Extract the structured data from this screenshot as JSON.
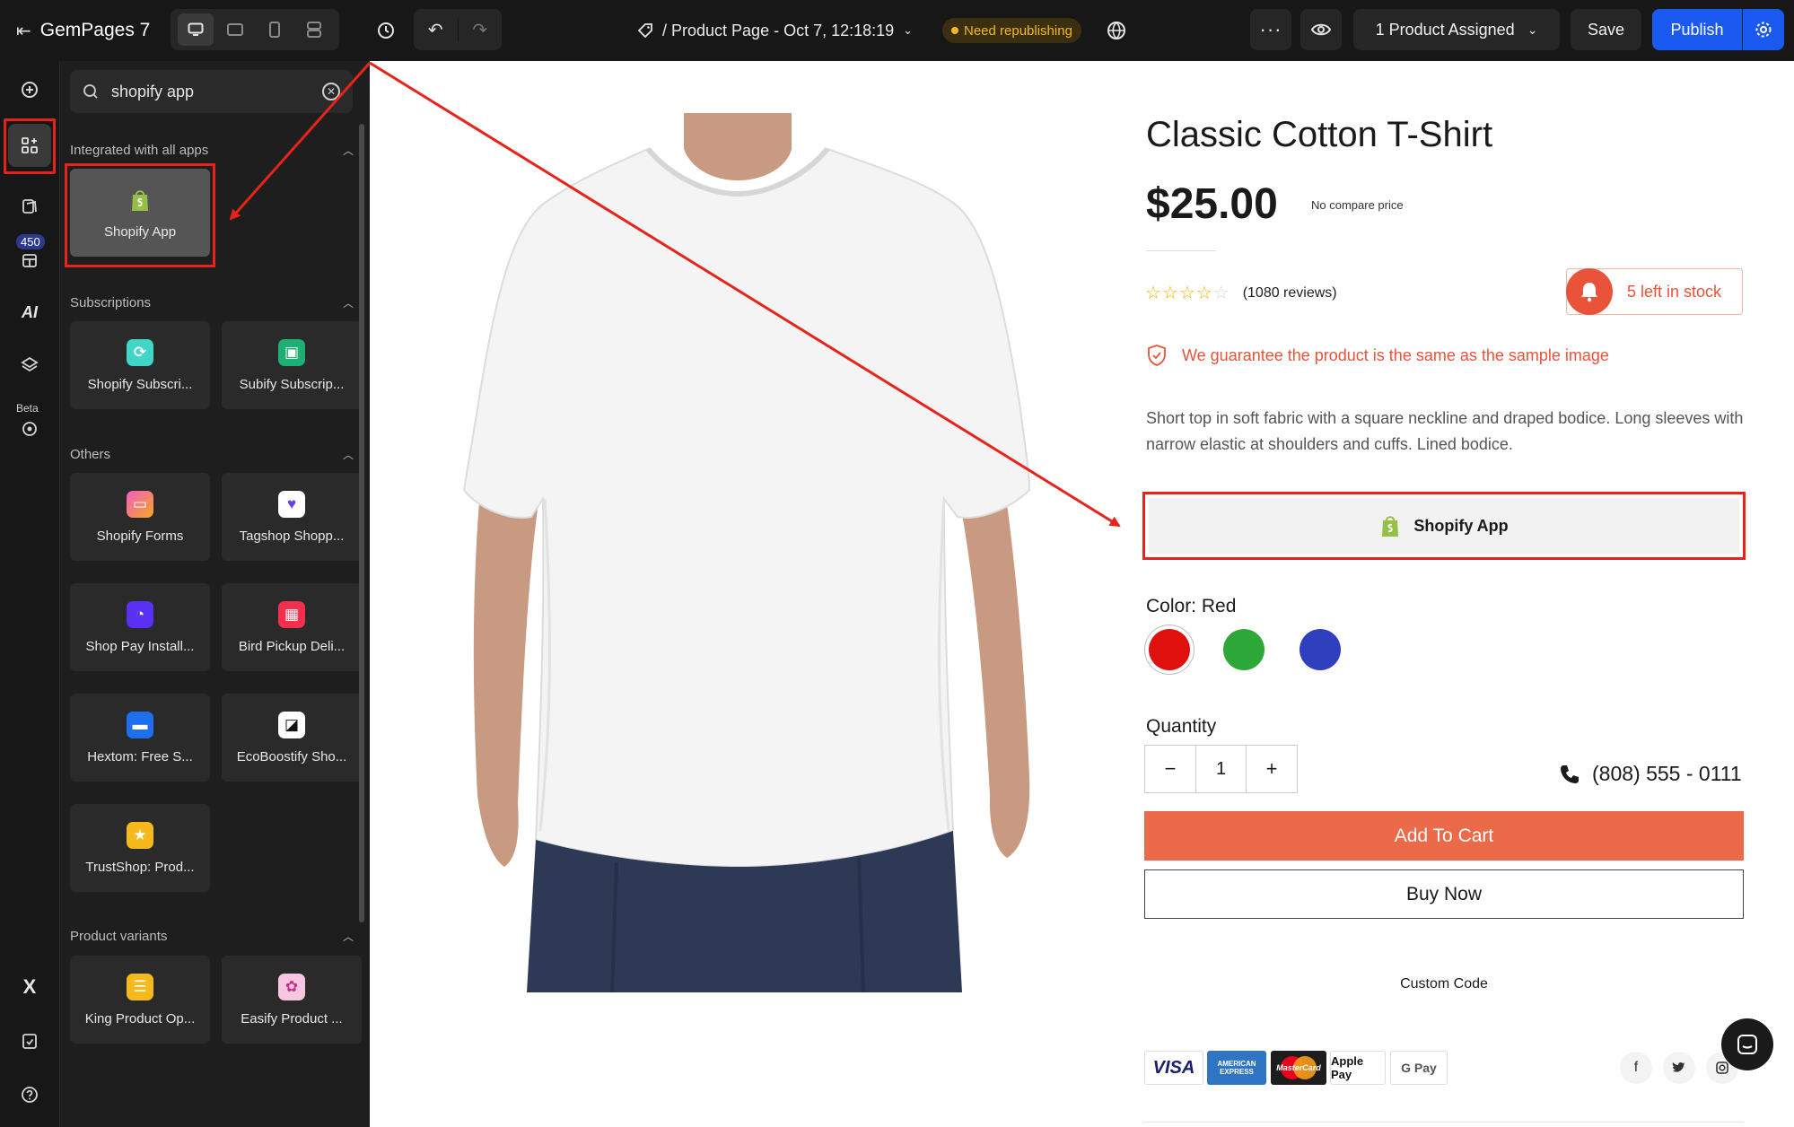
{
  "topbar": {
    "app_name": "GemPages 7",
    "page_title": "/ Product Page - Oct 7, 12:18:19",
    "status_badge": "Need republishing",
    "assigned_label": "1 Product Assigned",
    "save_label": "Save",
    "publish_label": "Publish"
  },
  "rail": {
    "count_badge": "450",
    "beta_badge": "Beta",
    "ai_label": "AI"
  },
  "panel": {
    "search": {
      "value": "shopify app"
    },
    "sections": [
      {
        "title": "Integrated with all apps",
        "items": [
          {
            "label": "Shopify App"
          }
        ]
      },
      {
        "title": "Subscriptions",
        "items": [
          {
            "label": "Shopify Subscri..."
          },
          {
            "label": "Subify Subscrip..."
          }
        ]
      },
      {
        "title": "Others",
        "items": [
          {
            "label": "Shopify Forms"
          },
          {
            "label": "Tagshop Shopp..."
          },
          {
            "label": "Shop Pay Install..."
          },
          {
            "label": "Bird Pickup Deli..."
          },
          {
            "label": "Hextom: Free S..."
          },
          {
            "label": "EcoBoostify Sho..."
          },
          {
            "label": "TrustShop: Prod..."
          }
        ]
      },
      {
        "title": "Product variants",
        "items": [
          {
            "label": "King Product Op..."
          },
          {
            "label": "Easify Product ..."
          }
        ]
      }
    ]
  },
  "product": {
    "title": "Classic Cotton T-Shirt",
    "price": "$25.00",
    "compare_price": "No compare price",
    "rating": 0,
    "reviews": "(1080 reviews)",
    "stock": "5 left in stock",
    "guarantee": "We guarantee the product is the same as the sample image",
    "description": "Short top in soft fabric with a square neckline and draped bodice. Long sleeves with narrow elastic at shoulders and cuffs. Lined bodice.",
    "shopify_app_label": "Shopify App",
    "color_label": "Color:",
    "color_value": "Red",
    "colors": [
      "#e0100f",
      "#2fa83a",
      "#2f3fbe"
    ],
    "quantity_label": "Quantity",
    "quantity": "1",
    "phone": "(808) 555 - 0111",
    "add_to_cart": "Add To Cart",
    "buy_now": "Buy Now",
    "custom_code": "Custom Code",
    "payments": [
      "VISA",
      "AMERICAN EXPRESS",
      "MasterCard",
      "Apple Pay",
      "G Pay"
    ]
  },
  "colors": {
    "accent_blue": "#1b5af0",
    "highlight_red": "#e8231a",
    "cta_orange": "#eb6a4a"
  }
}
